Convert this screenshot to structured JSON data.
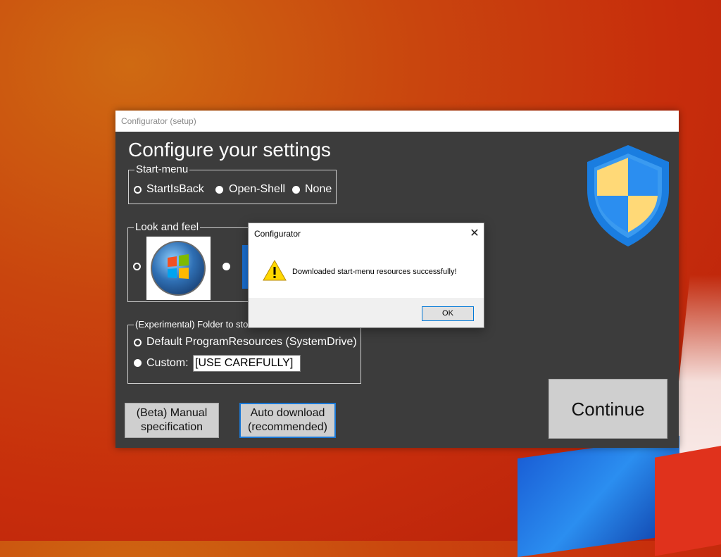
{
  "window": {
    "title": "Configurator (setup)",
    "heading": "Configure your settings"
  },
  "start_menu": {
    "legend": "Start-menu",
    "options": [
      {
        "label": "StartIsBack",
        "selected": true
      },
      {
        "label": "Open-Shell",
        "selected": false
      },
      {
        "label": "None",
        "selected": false
      }
    ]
  },
  "look_and_feel": {
    "legend": "Look and feel"
  },
  "folder": {
    "legend": "(Experimental) Folder to sto",
    "options": [
      {
        "label": "Default ProgramResources (SystemDrive)",
        "selected": true
      },
      {
        "label": "Custom:",
        "selected": false
      }
    ],
    "custom_value": "[USE CAREFULLY]"
  },
  "buttons": {
    "manual_line1": "(Beta) Manual",
    "manual_line2": "specification",
    "auto_line1": "Auto download",
    "auto_line2": "(recommended)",
    "continue": "Continue"
  },
  "dialog": {
    "title": "Configurator",
    "message": "Downloaded start-menu resources successfully!",
    "ok": "OK",
    "icon": "warning-icon"
  },
  "colors": {
    "window_bg": "#3c3c3c",
    "accent": "#1a78d6",
    "shield_blue": "#1e88e5",
    "shield_yellow": "#ffd977"
  }
}
